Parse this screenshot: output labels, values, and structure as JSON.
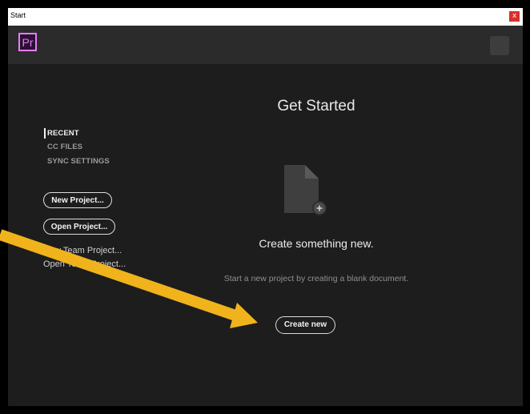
{
  "window": {
    "title": "Start",
    "close_glyph": "x"
  },
  "header": {
    "app_logo_text": "Pr",
    "logo_color": "#e77cf8"
  },
  "sidebar": {
    "nav_items": [
      {
        "label": "RECENT",
        "active": true
      },
      {
        "label": "CC FILES",
        "active": false
      },
      {
        "label": "SYNC SETTINGS",
        "active": false
      }
    ],
    "new_project_label": "New Project...",
    "open_project_label": "Open Project...",
    "new_team_project_label": "New Team Project...",
    "open_team_project_label": "Open Team Project..."
  },
  "main": {
    "title": "Get Started",
    "empty_heading": "Create something new.",
    "empty_description": "Start a new project by creating a blank document.",
    "create_new_label": "Create new",
    "doc_icon": "new-document-icon"
  },
  "annotation": {
    "arrow_color": "#f0b31c"
  }
}
